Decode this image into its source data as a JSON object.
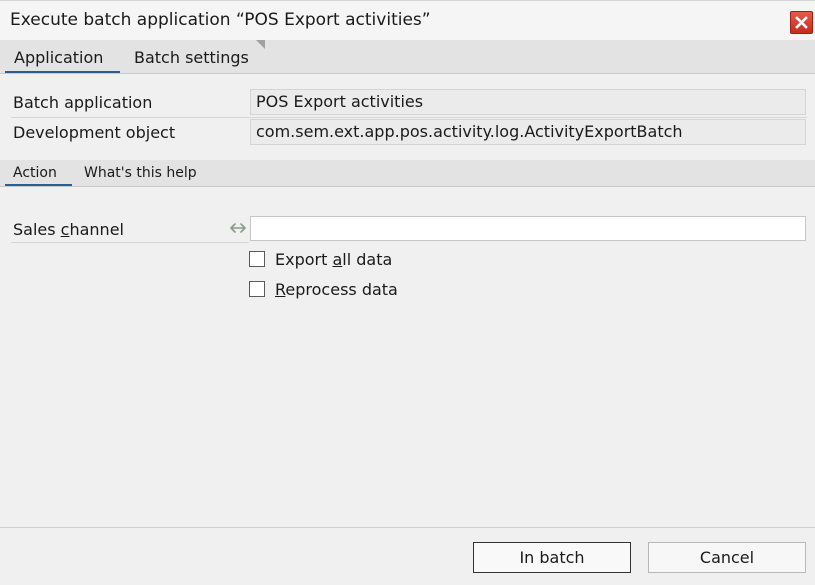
{
  "window": {
    "title": "Execute batch application “POS Export activities”",
    "close_icon": "close-icon"
  },
  "tabs": [
    {
      "label": "Application",
      "active": true
    },
    {
      "label": "Batch settings",
      "active": false
    }
  ],
  "fields": {
    "batch_application": {
      "label": "Batch application",
      "value": "POS Export activities"
    },
    "development_object": {
      "label": "Development object",
      "value": "com.sem.ext.app.pos.activity.log.ActivityExportBatch"
    }
  },
  "subtabs": [
    {
      "label": "Action",
      "active": true
    },
    {
      "label": "What's this help",
      "active": false
    }
  ],
  "action": {
    "sales_channel": {
      "label_pre": "Sales ",
      "label_mnemonic": "c",
      "label_post": "hannel",
      "value": "",
      "icon": "swap-arrows-icon"
    },
    "export_all": {
      "label_pre": "Export ",
      "label_mnemonic": "a",
      "label_post": "ll data",
      "checked": false
    },
    "reprocess": {
      "label_pre": "",
      "label_mnemonic": "R",
      "label_post": "eprocess data",
      "checked": false
    }
  },
  "buttons": {
    "in_batch": "In batch",
    "cancel": "Cancel"
  },
  "colors": {
    "accent": "#2a5e8c",
    "close_red": "#d23a2b"
  }
}
